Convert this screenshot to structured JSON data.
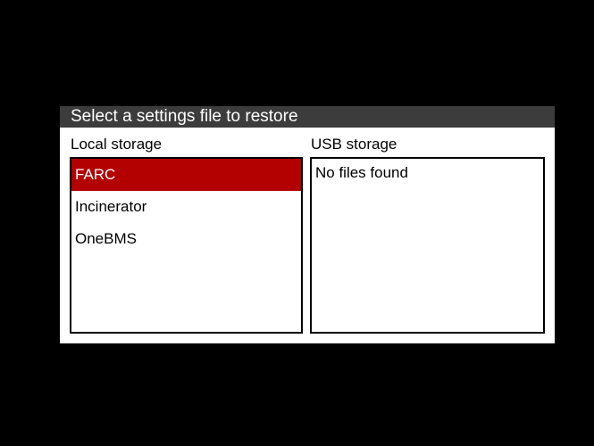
{
  "dialog": {
    "title": "Select a settings file to restore"
  },
  "local": {
    "label": "Local storage",
    "items": [
      {
        "label": "FARC",
        "selected": true
      },
      {
        "label": "Incinerator",
        "selected": false
      },
      {
        "label": "OneBMS",
        "selected": false
      }
    ]
  },
  "usb": {
    "label": "USB storage",
    "empty_message": "No files found"
  },
  "colors": {
    "background": "#000000",
    "title_bar": "#3c3c3c",
    "selection": "#b30000",
    "dialog": "#ffffff"
  }
}
